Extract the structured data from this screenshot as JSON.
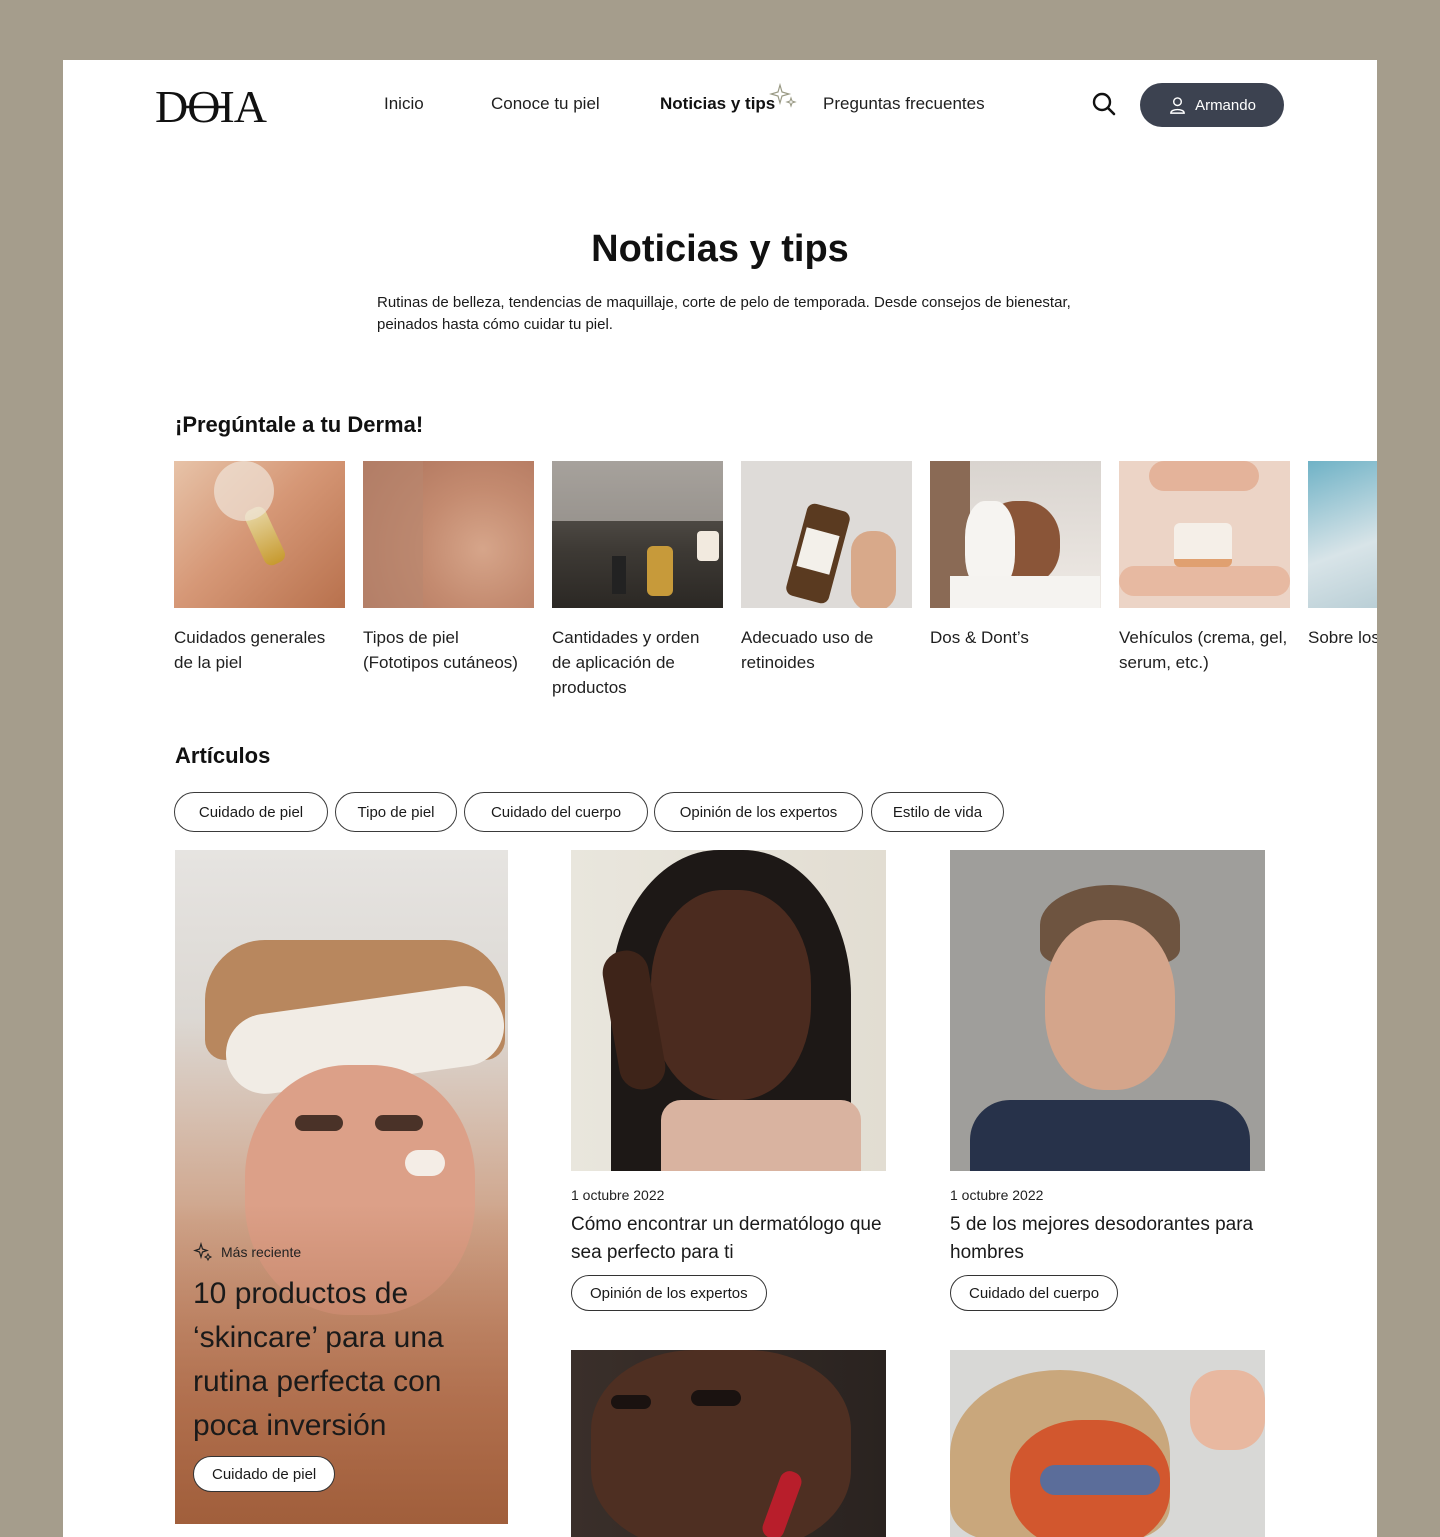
{
  "header": {
    "logo_text": "DOIA",
    "nav": [
      {
        "label": "Inicio"
      },
      {
        "label": "Conoce tu piel"
      },
      {
        "label": "Noticias y tips"
      },
      {
        "label": "Preguntas frecuentes"
      }
    ],
    "user_label": "Armando"
  },
  "hero": {
    "title": "Noticias y tips",
    "intro": "Rutinas de belleza, tendencias de maquillaje, corte de pelo de temporada. Desde consejos de bienestar, peinados hasta cómo cuidar tu piel."
  },
  "derma": {
    "title": "¡Pregúntale a tu Derma!",
    "items": [
      {
        "label": "Cuidados generales de la piel"
      },
      {
        "label": "Tipos de piel (Fototipos cutáneos)"
      },
      {
        "label": "Cantidades y orden de aplicación de productos"
      },
      {
        "label": "Adecuado uso de retinoides"
      },
      {
        "label": "Dos & Dont’s"
      },
      {
        "label": "Vehículos (crema, gel, serum, etc.)"
      },
      {
        "label": "Sobre los protectores"
      }
    ]
  },
  "articles": {
    "title": "Artículos",
    "filters": [
      "Cuidado de piel",
      "Tipo de piel",
      "Cuidado del cuerpo",
      "Opinión de los expertos",
      "Estilo de vida"
    ],
    "featured": {
      "badge": "Más reciente",
      "title": "10 productos de ‘skincare’ para una rutina perfecta con poca inversión",
      "tag": "Cuidado de piel"
    },
    "cards": [
      {
        "date": "1 octubre 2022",
        "title": "Cómo encontrar un dermatólogo que sea perfecto para ti",
        "tag": "Opinión de los expertos"
      },
      {
        "date": "1 octubre 2022",
        "title": "5 de los mejores desodorantes para hombres",
        "tag": "Cuidado del cuerpo"
      }
    ]
  },
  "colors": {
    "background": "#a59d8c",
    "user_button": "#3c4250",
    "surface": "#ffffff"
  }
}
